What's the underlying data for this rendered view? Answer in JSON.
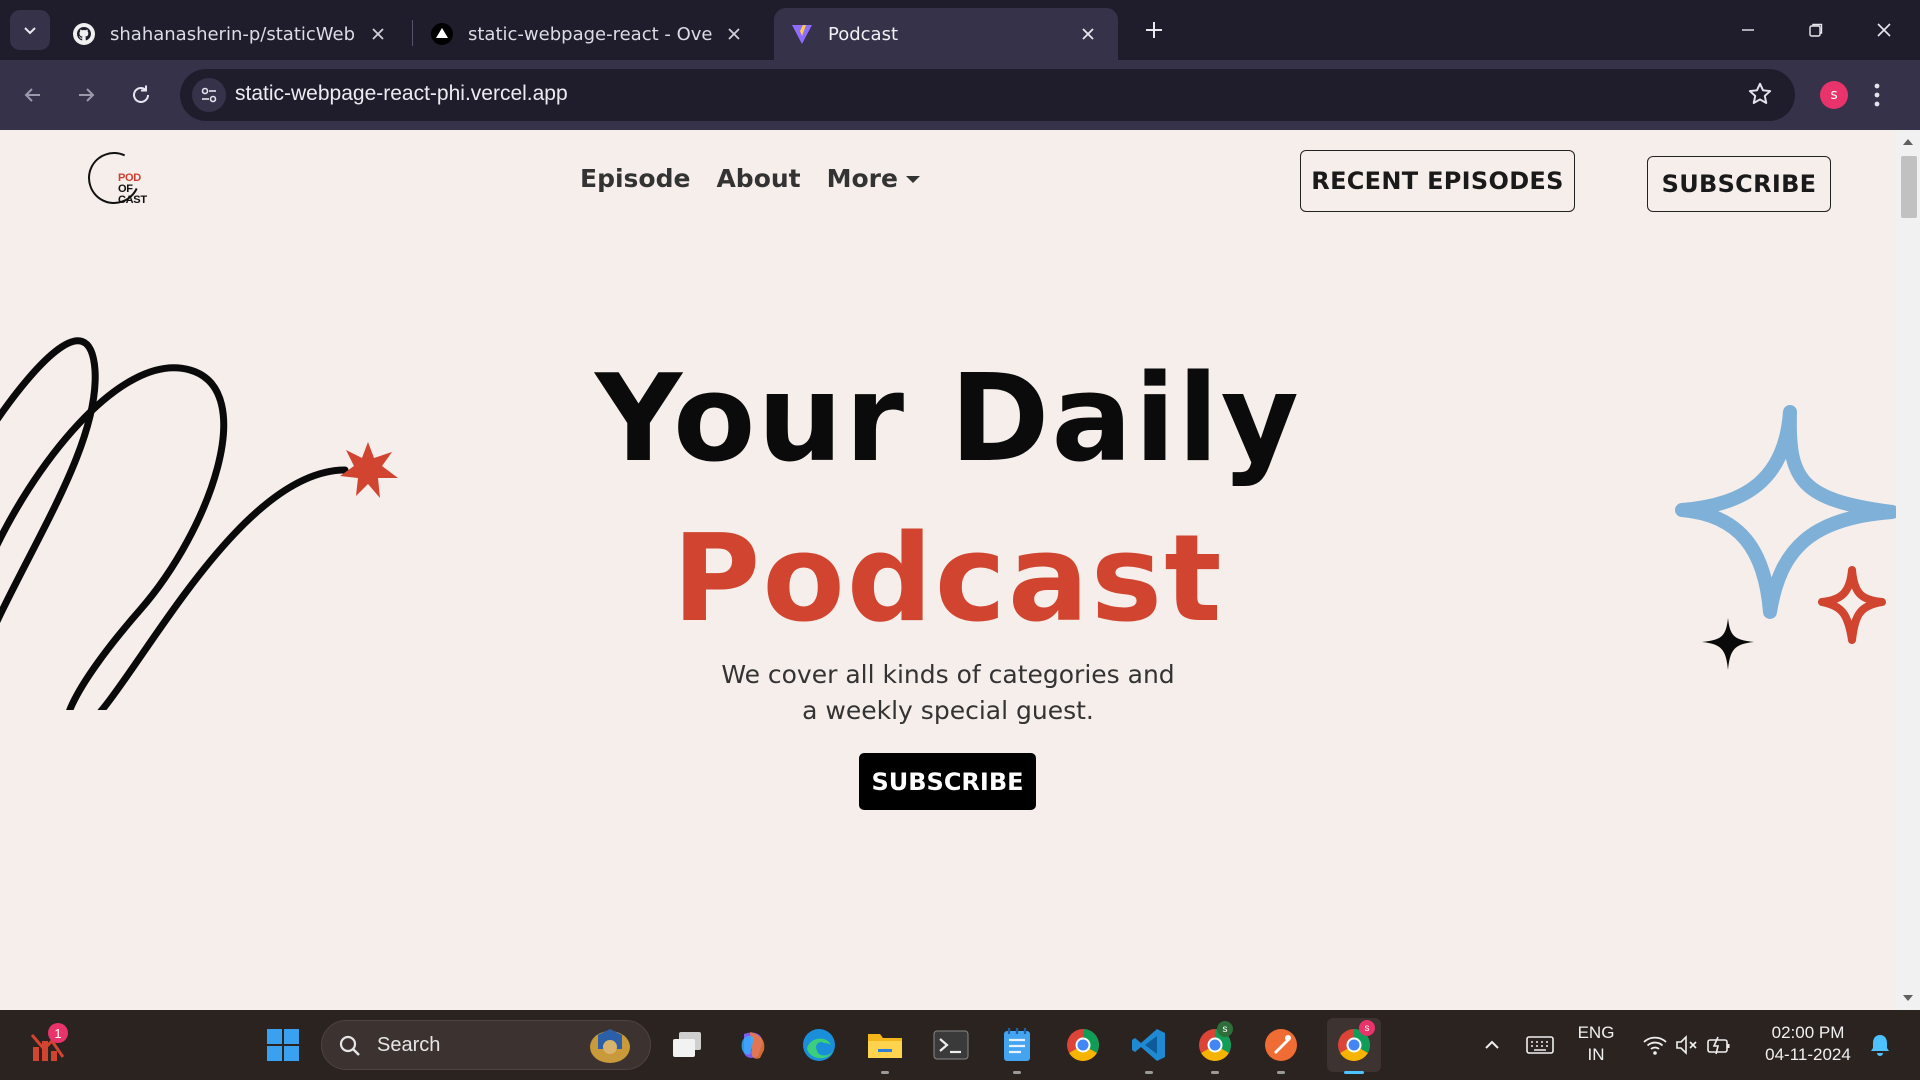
{
  "browser": {
    "tabs": [
      {
        "title": "shahanasherin-p/staticWebpag",
        "icon": "github-icon",
        "active": false
      },
      {
        "title": "static-webpage-react - Overvie",
        "icon": "vercel-icon",
        "active": false
      },
      {
        "title": "Podcast",
        "icon": "vite-icon",
        "active": true
      }
    ],
    "url": "static-webpage-react-phi.vercel.app",
    "profile_initial": "s"
  },
  "page": {
    "logo": {
      "line1": "POD",
      "line2": "OF",
      "line3": "CAST"
    },
    "nav": {
      "episode": "Episode",
      "about": "About",
      "more": "More"
    },
    "buttons": {
      "recent_episodes": "RECENT EPISODES",
      "subscribe_top": "SUBSCRIBE",
      "subscribe_hero": "SUBSCRIBE"
    },
    "hero": {
      "line1": "Your Daily",
      "line2": "Podcast",
      "subtitle_line1": "We cover all kinds of categories and",
      "subtitle_line2": "a weekly special guest."
    },
    "colors": {
      "accent": "#d1442f",
      "background": "#f5eeea",
      "sparkle_blue": "#7fb0d8"
    }
  },
  "taskbar": {
    "search_placeholder": "Search",
    "notification_count": "1",
    "language": "ENG",
    "region": "IN",
    "time": "02:00 PM",
    "date": "04-11-2024",
    "chrome_badge_1": "s",
    "chrome_badge_2": "s"
  }
}
